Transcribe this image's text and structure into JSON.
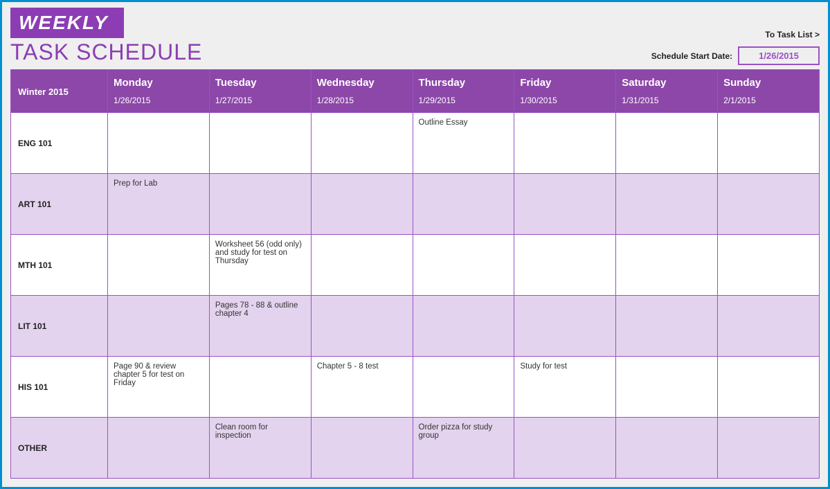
{
  "title": {
    "banner": "WEEKLY",
    "subtitle": "TASK SCHEDULE"
  },
  "meta": {
    "to_task_list": "To Task List >",
    "start_date_label": "Schedule Start Date:",
    "start_date": "1/26/2015"
  },
  "period_label": "Winter 2015",
  "days": [
    {
      "name": "Monday",
      "date": "1/26/2015"
    },
    {
      "name": "Tuesday",
      "date": "1/27/2015"
    },
    {
      "name": "Wednesday",
      "date": "1/28/2015"
    },
    {
      "name": "Thursday",
      "date": "1/29/2015"
    },
    {
      "name": "Friday",
      "date": "1/30/2015"
    },
    {
      "name": "Saturday",
      "date": "1/31/2015"
    },
    {
      "name": "Sunday",
      "date": "2/1/2015"
    }
  ],
  "rows": [
    {
      "label": "ENG 101",
      "cells": [
        "",
        "",
        "",
        "Outline Essay",
        "",
        "",
        ""
      ]
    },
    {
      "label": "ART 101",
      "cells": [
        "Prep for Lab",
        "",
        "",
        "",
        "",
        "",
        ""
      ]
    },
    {
      "label": "MTH 101",
      "cells": [
        "",
        "Worksheet 56 (odd only) and study for test on Thursday",
        "",
        "",
        "",
        "",
        ""
      ]
    },
    {
      "label": "LIT 101",
      "cells": [
        "",
        "Pages 78 - 88 & outline chapter 4",
        "",
        "",
        "",
        "",
        ""
      ]
    },
    {
      "label": "HIS 101",
      "cells": [
        "Page 90 & review chapter 5 for test on Friday",
        "",
        "Chapter 5 - 8 test",
        "",
        "Study for test",
        "",
        ""
      ]
    },
    {
      "label": "OTHER",
      "cells": [
        "",
        "Clean room for inspection",
        "",
        "Order pizza for study group",
        "",
        "",
        ""
      ]
    }
  ]
}
